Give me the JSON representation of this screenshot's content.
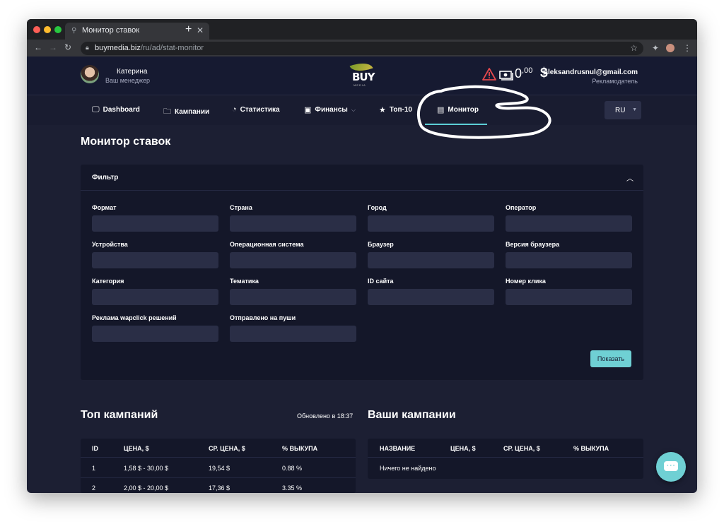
{
  "browser": {
    "tab_title": "Монитор ставок",
    "url_host": "buymedia.biz",
    "url_path": "/ru/ad/stat-monitor"
  },
  "header": {
    "user_name": "Катерина",
    "user_role": "Ваш менеджер",
    "logo_text": "BUY",
    "logo_sub": "MEDIA",
    "balance_main": "0",
    "balance_cents": ",00",
    "currency": "$",
    "email": "aleksandrusnul@gmail.com",
    "account_role": "Рекламодатель"
  },
  "nav": {
    "items": [
      {
        "label": "Dashboard",
        "icon": "monitor-icon"
      },
      {
        "label": "Кампании",
        "icon": "folder-icon"
      },
      {
        "label": "Статистика",
        "icon": "pie-chart-icon"
      },
      {
        "label": "Финансы",
        "icon": "money-icon"
      },
      {
        "label": "Топ-10",
        "icon": "star-icon"
      },
      {
        "label": "Монитор",
        "icon": "document-icon"
      }
    ],
    "active": "Монитор",
    "lang": "RU"
  },
  "page": {
    "title": "Монитор ставок"
  },
  "filter": {
    "title": "Фильтр",
    "fields": [
      {
        "label": "Формат",
        "value": ""
      },
      {
        "label": "Страна",
        "value": ""
      },
      {
        "label": "Город",
        "value": ""
      },
      {
        "label": "Оператор",
        "value": ""
      },
      {
        "label": "Устройства",
        "value": ""
      },
      {
        "label": "Операционная система",
        "value": ""
      },
      {
        "label": "Браузер",
        "value": ""
      },
      {
        "label": "Версия браузера",
        "value": ""
      },
      {
        "label": "Категория",
        "value": ""
      },
      {
        "label": "Тематика",
        "value": ""
      },
      {
        "label": "ID сайта",
        "value": ""
      },
      {
        "label": "Номер клика",
        "value": ""
      },
      {
        "label": "Реклама wapclick решений",
        "value": ""
      },
      {
        "label": "Отправлено на пуши",
        "value": ""
      }
    ],
    "show_button": "Показать"
  },
  "top_campaigns": {
    "title": "Топ кампаний",
    "updated": "Обновлено в 18:37",
    "columns": [
      "ID",
      "ЦЕНА, $",
      "СР. ЦЕНА, $",
      "% ВЫКУПА"
    ],
    "rows": [
      [
        "1",
        "1,58 $ - 30,00 $",
        "19,54 $",
        "0.88 %"
      ],
      [
        "2",
        "2,00 $ - 20,00 $",
        "17,36 $",
        "3.35 %"
      ]
    ]
  },
  "your_campaigns": {
    "title": "Ваши кампании",
    "columns": [
      "НАЗВАНИЕ",
      "ЦЕНА, $",
      "СР. ЦЕНА, $",
      "% ВЫКУПА"
    ],
    "empty_text": "Ничего не найдено"
  },
  "colors": {
    "accent": "#6fd0d4",
    "background": "#1c1f33",
    "card": "#141729",
    "input": "#2a2e46"
  }
}
